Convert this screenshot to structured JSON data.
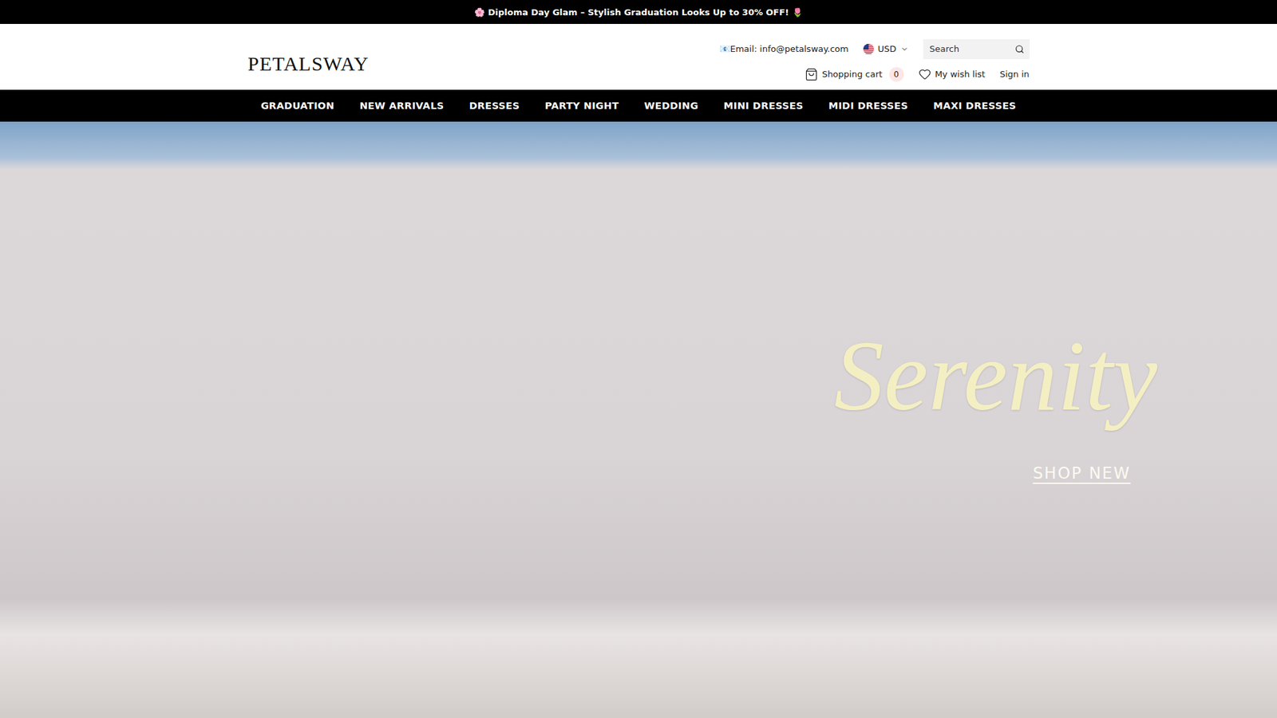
{
  "announcement": "🌸 Diploma Day Glam – Stylish Graduation Looks Up to 30% OFF! 🌷",
  "header": {
    "logo": "PETALSWAY",
    "email": "📧Email: info@petalsway.com",
    "currency": "USD",
    "search": {
      "placeholder": "Search"
    },
    "cart": {
      "label": "Shopping cart",
      "count": "0"
    },
    "wishlist": "My wish list",
    "sign_in": "Sign in"
  },
  "nav": [
    "GRADUATION",
    "NEW ARRIVALS",
    "DRESSES",
    "PARTY NIGHT",
    "WEDDING",
    "MINI DRESSES",
    "MIDI DRESSES",
    "MAXI DRESSES"
  ],
  "hero": {
    "title": "Serenity",
    "cta": "SHOP NEW"
  }
}
